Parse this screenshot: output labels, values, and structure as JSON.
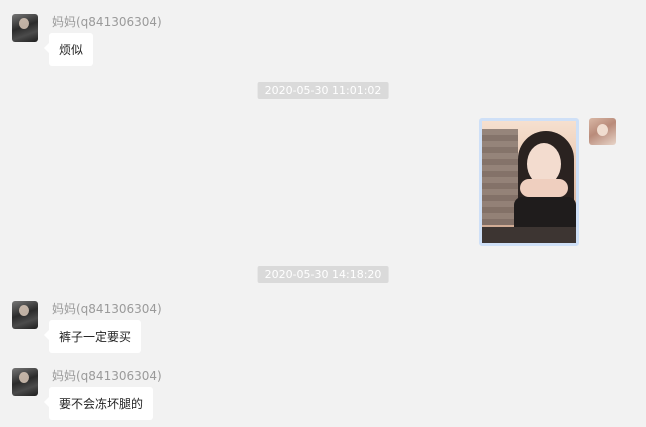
{
  "messages": [
    {
      "sender": "妈妈(q841306304)",
      "text": "烦似"
    },
    {
      "timestamp": "2020-05-30 11:01:02"
    },
    {
      "sender": "self",
      "type": "image"
    },
    {
      "timestamp": "2020-05-30 14:18:20"
    },
    {
      "sender": "妈妈(q841306304)",
      "text": "裤子一定要买"
    },
    {
      "sender": "妈妈(q841306304)",
      "text": "要不会冻坏腿的"
    }
  ],
  "sender_name": "妈妈(q841306304)",
  "timestamps": [
    "2020-05-30 11:01:02",
    "2020-05-30 14:18:20"
  ],
  "texts": [
    "烦似",
    "裤子一定要买",
    "要不会冻坏腿的"
  ],
  "colors": {
    "background": "#f2f2f2",
    "bubble": "#ffffff",
    "timestamp_bg": "#dadada",
    "sender_name": "#9a9a9a",
    "image_border": "#cfe0f7"
  }
}
